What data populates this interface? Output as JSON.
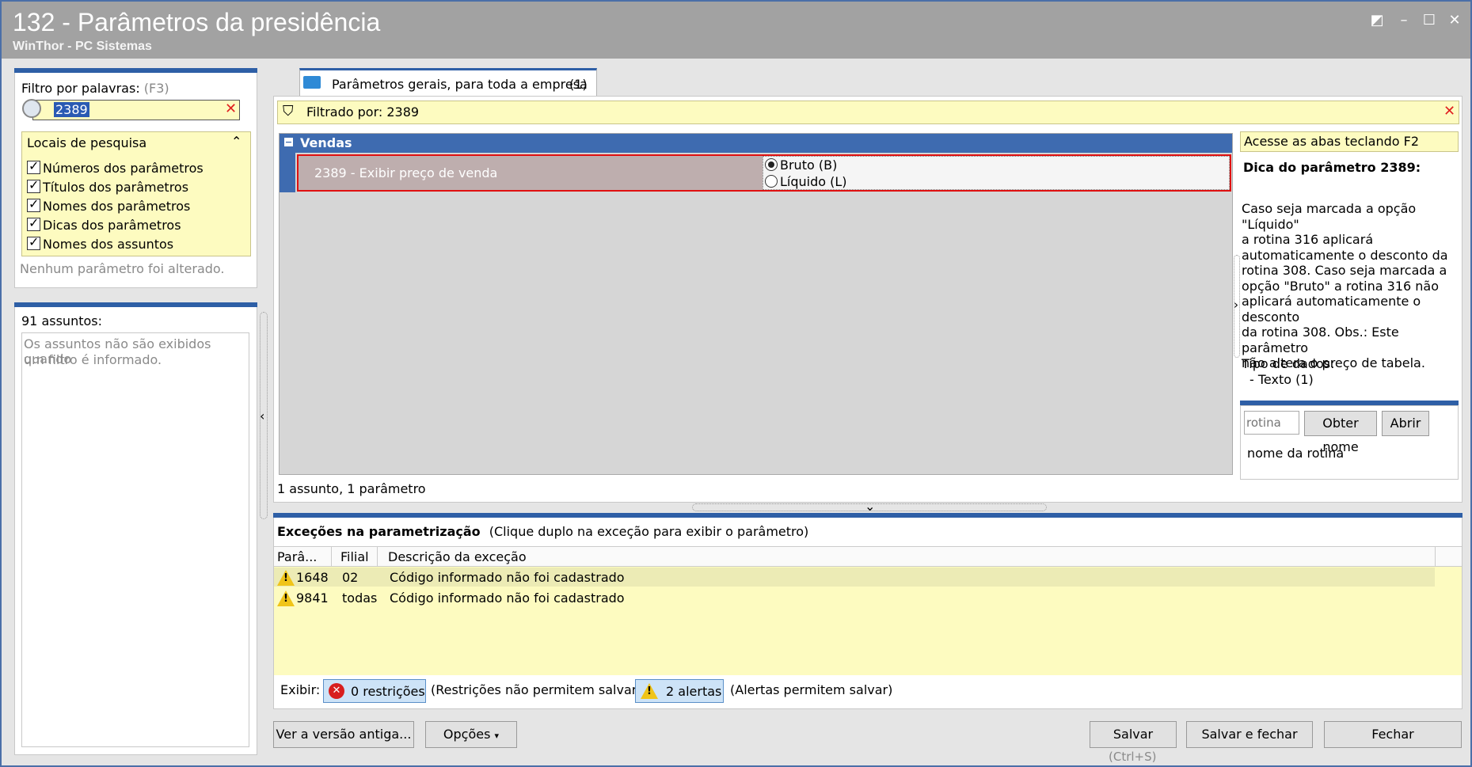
{
  "window": {
    "title": "132 - Parâmetros da presidência",
    "subtitle": "WinThor - PC Sistemas"
  },
  "filter": {
    "label": "Filtro por palavras:",
    "shortcut": "(F3)",
    "value": "2389",
    "search_locations_label": "Locais de pesquisa",
    "locations": [
      "Números dos parâmetros",
      "Títulos dos parâmetros",
      "Nomes dos parâmetros",
      "Dicas dos parâmetros",
      "Nomes dos assuntos"
    ],
    "status": "Nenhum parâmetro foi alterado."
  },
  "subjects": {
    "count_label": "91 assuntos:",
    "empty_message_line1": "Os assuntos não são exibidos quando",
    "empty_message_line2": "um filtro é informado."
  },
  "tab": {
    "label": "Parâmetros gerais, para toda a empresa",
    "count": "(1)"
  },
  "filtered_by": "Filtrado por: 2389",
  "group": {
    "name": "Vendas",
    "param_label": "2389 - Exibir preço de venda",
    "options": [
      "Bruto (B)",
      "Líquido (L)"
    ],
    "selected": 0
  },
  "summary": "1 assunto, 1 parâmetro",
  "hint": {
    "access_tip": "Acesse as abas teclando F2",
    "title": "Dica do parâmetro 2389:",
    "lines": [
      "Caso seja marcada a opção \"Líquido\"",
      "a rotina 316 aplicará",
      "automaticamente o desconto da",
      "rotina 308. Caso seja marcada a",
      "opção \"Bruto\" a rotina 316 não",
      "aplicará automaticamente o desconto",
      "da rotina 308. Obs.: Este parâmetro",
      "não altera o preço de tabela."
    ],
    "data_type_label": "Tipo de dados:",
    "data_type_value": "- Texto (1)"
  },
  "routine": {
    "placeholder": "rotina",
    "get_name_label": "Obter nome",
    "open_label": "Abrir",
    "name_label": "nome da rotina"
  },
  "exceptions": {
    "title": "Exceções na parametrização",
    "hint": "(Clique duplo na exceção para exibir o parâmetro)",
    "columns": [
      "Parâ...",
      "Filial",
      "Descrição da exceção"
    ],
    "rows": [
      {
        "param": "1648",
        "filial": "02",
        "desc": "Código informado não foi cadastrado"
      },
      {
        "param": "9841",
        "filial": "todas",
        "desc": "Código informado não foi cadastrado"
      }
    ],
    "show_label": "Exibir:",
    "restrictions_label": "0 restrições",
    "restrictions_note": "(Restrições não permitem salvar)",
    "alerts_label": "2 alertas",
    "alerts_note": "(Alertas permitem salvar)"
  },
  "footer": {
    "old_version_label": "Ver a versão antiga...",
    "options_label": "Opções",
    "save_label": "Salvar",
    "save_shortcut": "(Ctrl+S)",
    "save_close_label": "Salvar e fechar",
    "close_label": "Fechar"
  }
}
